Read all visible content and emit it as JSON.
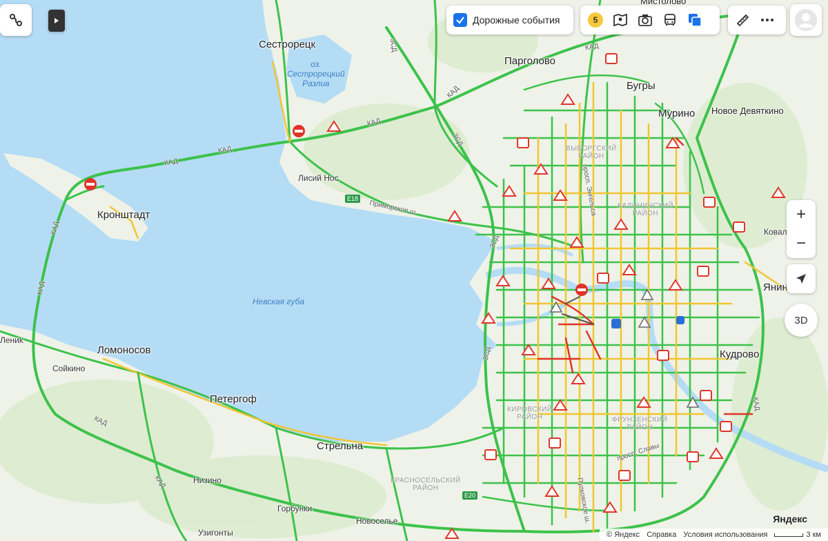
{
  "toolbar": {
    "traffic_events_label": "Дорожные события",
    "traffic_score": "5"
  },
  "controls": {
    "zoom_in": "+",
    "zoom_out": "−",
    "view_3d": "3D"
  },
  "footer": {
    "copyright": "© Яндекс",
    "help": "Справка",
    "terms": "Условия использования",
    "brand": "Яндекс",
    "scale": "3 км"
  },
  "map": {
    "water": {
      "gulf": "Невская губа",
      "lake": "оз.\nСестрорецкий\nРазлив"
    },
    "places": {
      "sestroretsk": "Сестрорецк",
      "pargolovo": "Парголово",
      "bugry": "Бугры",
      "murino": "Мурино",
      "novoe_devyatkino": "Новое Девяткино",
      "mistolovo": "Мистолово",
      "lisiy_nos": "Лисий Нос",
      "kronshtadt": "Кронштадт",
      "lomonosov": "Ломоносов",
      "soykino": "Сойкино",
      "peterhof": "Петергоф",
      "strelna": "Стрельна",
      "nizino": "Низино",
      "gorbunki": "Горбунки",
      "novoselye": "Новоселье",
      "uzigonty": "Узигонты",
      "kudrovo": "Кудрово",
      "yanino": "Янино",
      "kovalevo": "Ковале",
      "lenino": "Лениk",
      "zelenogorsk": "Новосел"
    },
    "districts": {
      "vyborgsky": "ВЫБОРГСКИЙ\nРАЙОН",
      "kalininsky": "КАЛИНИНСКИЙ\nРАЙОН",
      "kirovsky": "КИРОВСКИЙ\nРАЙОН",
      "frunzensky": "ФРУНЗЕНСКИЙ\nРАЙОН",
      "krasnoselsky": "КРАСНОСЕЛЬСКИЙ\nРАЙОН"
    },
    "roads": {
      "kad": "КАД",
      "zsd": "ЗСД",
      "e18": "E18",
      "e20": "E20",
      "primorskoe": "Приморское ш.",
      "engelsa": "просп. Энгельса",
      "slavy": "просп. Славы",
      "pulkovskoe": "Пулковское ш."
    }
  },
  "colors": {
    "water": "#b5dcf5",
    "land": "#eef2e8",
    "traffic_free": "#3cc24a",
    "traffic_slow": "#f2c530",
    "traffic_jam": "#e0342a",
    "accent": "#1a73e8"
  }
}
